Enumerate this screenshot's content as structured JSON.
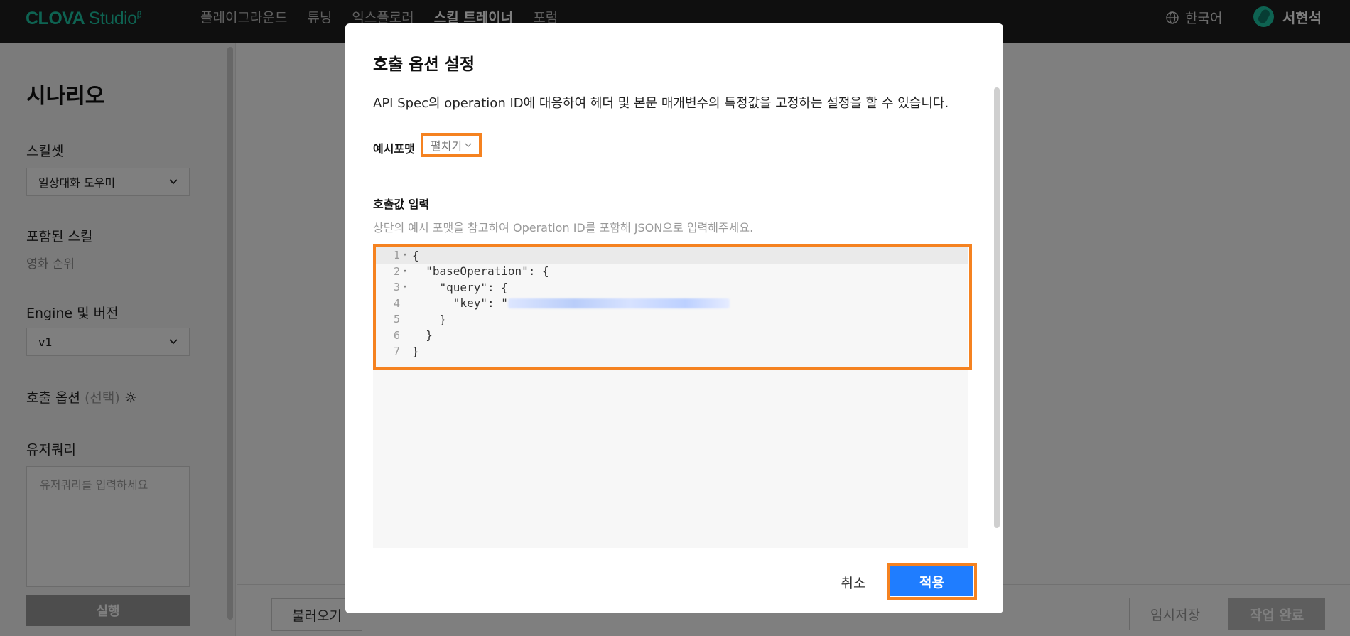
{
  "header": {
    "logo_text": "CLOVA",
    "logo_studio": "Studio",
    "logo_sup": "β",
    "nav": [
      {
        "label": "플레이그라운드",
        "active": false
      },
      {
        "label": "튜닝",
        "active": false
      },
      {
        "label": "익스플로러",
        "active": false
      },
      {
        "label": "스킬 트레이너",
        "active": true
      },
      {
        "label": "포럼",
        "active": false
      }
    ],
    "language": "한국어",
    "language_icon": "globe-icon",
    "user_name": "서현석"
  },
  "sidebar": {
    "title": "시나리오",
    "skillset_label": "스킬셋",
    "skillset_value": "일상대화 도우미",
    "included_skills_label": "포함된 스킬",
    "included_skills_value": "영화 순위",
    "engine_label": "Engine 및 버전",
    "engine_value": "v1",
    "call_option_label": "호출 옵션",
    "call_option_optional": "(선택)",
    "call_option_icon": "gear-icon",
    "user_query_label": "유저쿼리",
    "user_query_placeholder": "유저쿼리를 입력하세요",
    "run_button": "실행"
  },
  "footer": {
    "load_button": "불러오기",
    "temp_save_button": "임시저장",
    "complete_button": "작업 완료"
  },
  "modal": {
    "title": "호출 옵션 설정",
    "description": "API Spec의 operation ID에 대응하여 헤더 및 본문 매개변수의 특정값을 고정하는 설정을 할 수 있습니다.",
    "example_format_label": "예시포맷",
    "example_format_toggle": "펼치기",
    "input_label": "호출값 입력",
    "input_help": "상단의 예시 포맷을 참고하여 Operation ID를 포함해 JSON으로 입력해주세요.",
    "code_lines": [
      {
        "num": "1",
        "fold": "▾",
        "text": "{"
      },
      {
        "num": "2",
        "fold": "▾",
        "text": "  \"baseOperation\": {"
      },
      {
        "num": "3",
        "fold": "▾",
        "text": "    \"query\": {"
      },
      {
        "num": "4",
        "fold": "",
        "text": "      \"key\": \""
      },
      {
        "num": "5",
        "fold": "",
        "text": "    }"
      },
      {
        "num": "6",
        "fold": "",
        "text": "  }"
      },
      {
        "num": "7",
        "fold": "",
        "text": "}"
      }
    ],
    "cancel_button": "취소",
    "apply_button": "적용",
    "highlight_color": "#f58220",
    "apply_color": "#1f7dff"
  }
}
